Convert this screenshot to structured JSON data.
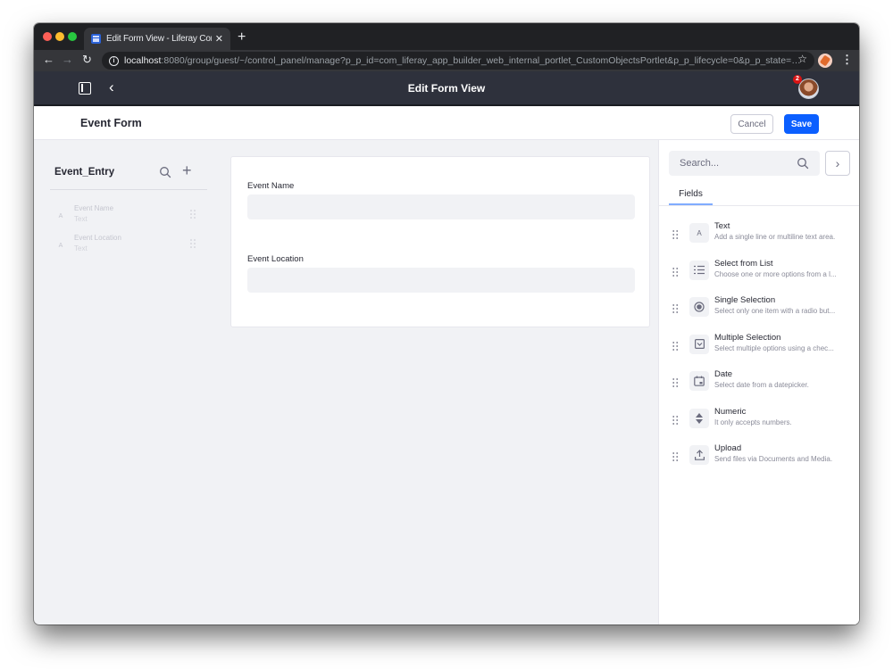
{
  "browser": {
    "tab_title": "Edit Form View - Liferay Commu",
    "url_host": "localhost",
    "url_rest": ":8080/group/guest/~/control_panel/manage?p_p_id=com_liferay_app_builder_web_internal_portlet_CustomObjectsPortlet&p_p_lifecycle=0&p_p_state=maximized..."
  },
  "appbar": {
    "title": "Edit Form View",
    "notification_count": "2"
  },
  "subbar": {
    "form_title": "Event Form",
    "cancel_label": "Cancel",
    "save_label": "Save"
  },
  "left_panel": {
    "data_type_name": "Event_Entry",
    "fields": [
      {
        "icon_glyph": "A",
        "name": "Event Name",
        "type": "Text"
      },
      {
        "icon_glyph": "A",
        "name": "Event Location",
        "type": "Text"
      }
    ]
  },
  "canvas": {
    "fields": [
      {
        "label": "Event Name",
        "value": ""
      },
      {
        "label": "Event Location",
        "value": ""
      }
    ]
  },
  "right_panel": {
    "search_placeholder": "Search...",
    "tab_label": "Fields",
    "field_types": [
      {
        "icon": "text-icon",
        "name": "Text",
        "description": "Add a single line or multiline text area."
      },
      {
        "icon": "list-icon",
        "name": "Select from List",
        "description": "Choose one or more options from a l..."
      },
      {
        "icon": "radio-icon",
        "name": "Single Selection",
        "description": "Select only one item with a radio but..."
      },
      {
        "icon": "checkbox-icon",
        "name": "Multiple Selection",
        "description": "Select multiple options using a chec..."
      },
      {
        "icon": "calendar-icon",
        "name": "Date",
        "description": "Select date from a datepicker."
      },
      {
        "icon": "numeric-icon",
        "name": "Numeric",
        "description": "It only accepts numbers."
      },
      {
        "icon": "upload-icon",
        "name": "Upload",
        "description": "Send files via Documents and Media."
      }
    ]
  },
  "colors": {
    "primary": "#0b5fff",
    "appbar_bg": "#2e313c",
    "canvas_bg": "#f1f2f5",
    "badge": "#da1414"
  }
}
